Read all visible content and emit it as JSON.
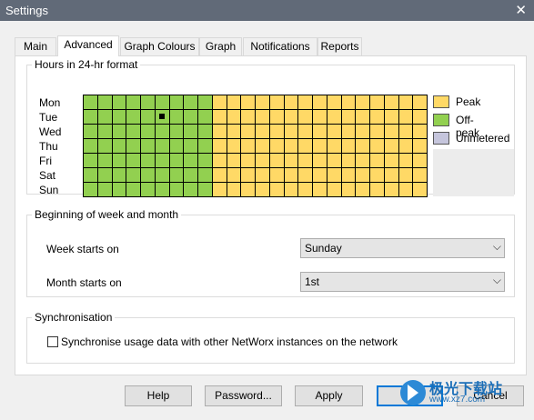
{
  "window": {
    "title": "Settings",
    "close_glyph": "✕"
  },
  "tabs": [
    {
      "label": "Main"
    },
    {
      "label": "Advanced",
      "active": true
    },
    {
      "label": "Graph Colours"
    },
    {
      "label": "Graph"
    },
    {
      "label": "Notifications"
    },
    {
      "label": "Reports"
    }
  ],
  "hours_group": {
    "legend": "Hours in 24-hr format",
    "days": [
      "Mon",
      "Tue",
      "Wed",
      "Thu",
      "Fri",
      "Sat",
      "Sun"
    ],
    "hours_per_day": 24,
    "offpeak_hour_count": 9,
    "selected_cell": {
      "day": "Tue",
      "hour": 5
    },
    "legend_items": [
      {
        "label": "Peak",
        "color": "#ffd966"
      },
      {
        "label": "Off-peak",
        "color": "#92d050"
      },
      {
        "label": "Unmetered",
        "color": "#c5c5dc"
      }
    ]
  },
  "week_group": {
    "legend": "Beginning of week and month",
    "week_label": "Week starts on",
    "week_value": "Sunday",
    "month_label": "Month starts on",
    "month_value": "1st",
    "chevron": "⌵"
  },
  "sync_group": {
    "legend": "Synchronisation",
    "checkbox_label": "Synchronise usage data with other NetWorx instances on the network",
    "checked": false
  },
  "buttons": {
    "help": "Help",
    "password": "Password...",
    "apply": "Apply",
    "ok": "OK",
    "cancel": "Cancel"
  },
  "watermark": {
    "text": "极光下载站",
    "sub": "www.xz7.com"
  },
  "colors": {
    "titlebar": "#616a78",
    "peak": "#ffd966",
    "offpeak": "#92d050",
    "accent": "#0078d7"
  }
}
